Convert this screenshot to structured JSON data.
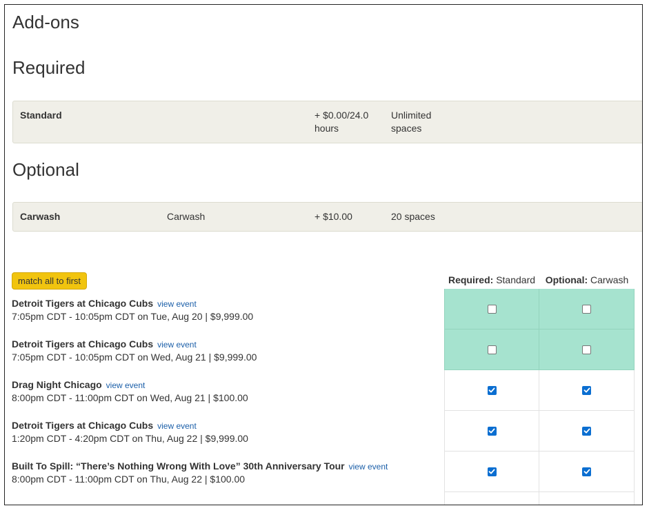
{
  "page_title": "Add-ons",
  "required": {
    "heading": "Required",
    "rows": [
      {
        "name": "Standard",
        "description": "",
        "price": "+ $0.00/24.0 hours",
        "price_line1": "+ $0.00/24.0",
        "price_line2": "hours",
        "capacity_line1": "Unlimited",
        "capacity_line2": "spaces"
      }
    ]
  },
  "optional": {
    "heading": "Optional",
    "rows": [
      {
        "name": "Carwash",
        "description": "Carwash",
        "price": "+ $10.00",
        "capacity": "20 spaces"
      }
    ]
  },
  "match_button_label": "match all to first",
  "columns": [
    {
      "prefix": "Required:",
      "name": "Standard"
    },
    {
      "prefix": "Optional:",
      "name": "Carwash"
    }
  ],
  "view_event_label": "view event",
  "events": [
    {
      "title": "Detroit Tigers at Chicago Cubs",
      "detail": "7:05pm CDT - 10:05pm CDT on Tue, Aug 20 | $9,999.00",
      "required_checked": false,
      "optional_checked": false,
      "highlight": true
    },
    {
      "title": "Detroit Tigers at Chicago Cubs",
      "detail": "7:05pm CDT - 10:05pm CDT on Wed, Aug 21 | $9,999.00",
      "required_checked": false,
      "optional_checked": false,
      "highlight": true
    },
    {
      "title": "Drag Night Chicago",
      "detail": "8:00pm CDT - 11:00pm CDT on Wed, Aug 21 | $100.00",
      "required_checked": true,
      "optional_checked": true,
      "highlight": false
    },
    {
      "title": "Detroit Tigers at Chicago Cubs",
      "detail": "1:20pm CDT - 4:20pm CDT on Thu, Aug 22 | $9,999.00",
      "required_checked": true,
      "optional_checked": true,
      "highlight": false
    },
    {
      "title": "Built To Spill: “There’s Nothing Wrong With Love” 30th Anniversary Tour",
      "detail": "8:00pm CDT - 11:00pm CDT on Thu, Aug 22 | $100.00",
      "required_checked": true,
      "optional_checked": true,
      "highlight": false
    }
  ],
  "colors": {
    "highlight": "#a6e3cf",
    "button": "#f1c40f",
    "checkbox": "#0a6ed1",
    "link": "#1a5ea8",
    "addon_bg": "#f0efe8"
  }
}
